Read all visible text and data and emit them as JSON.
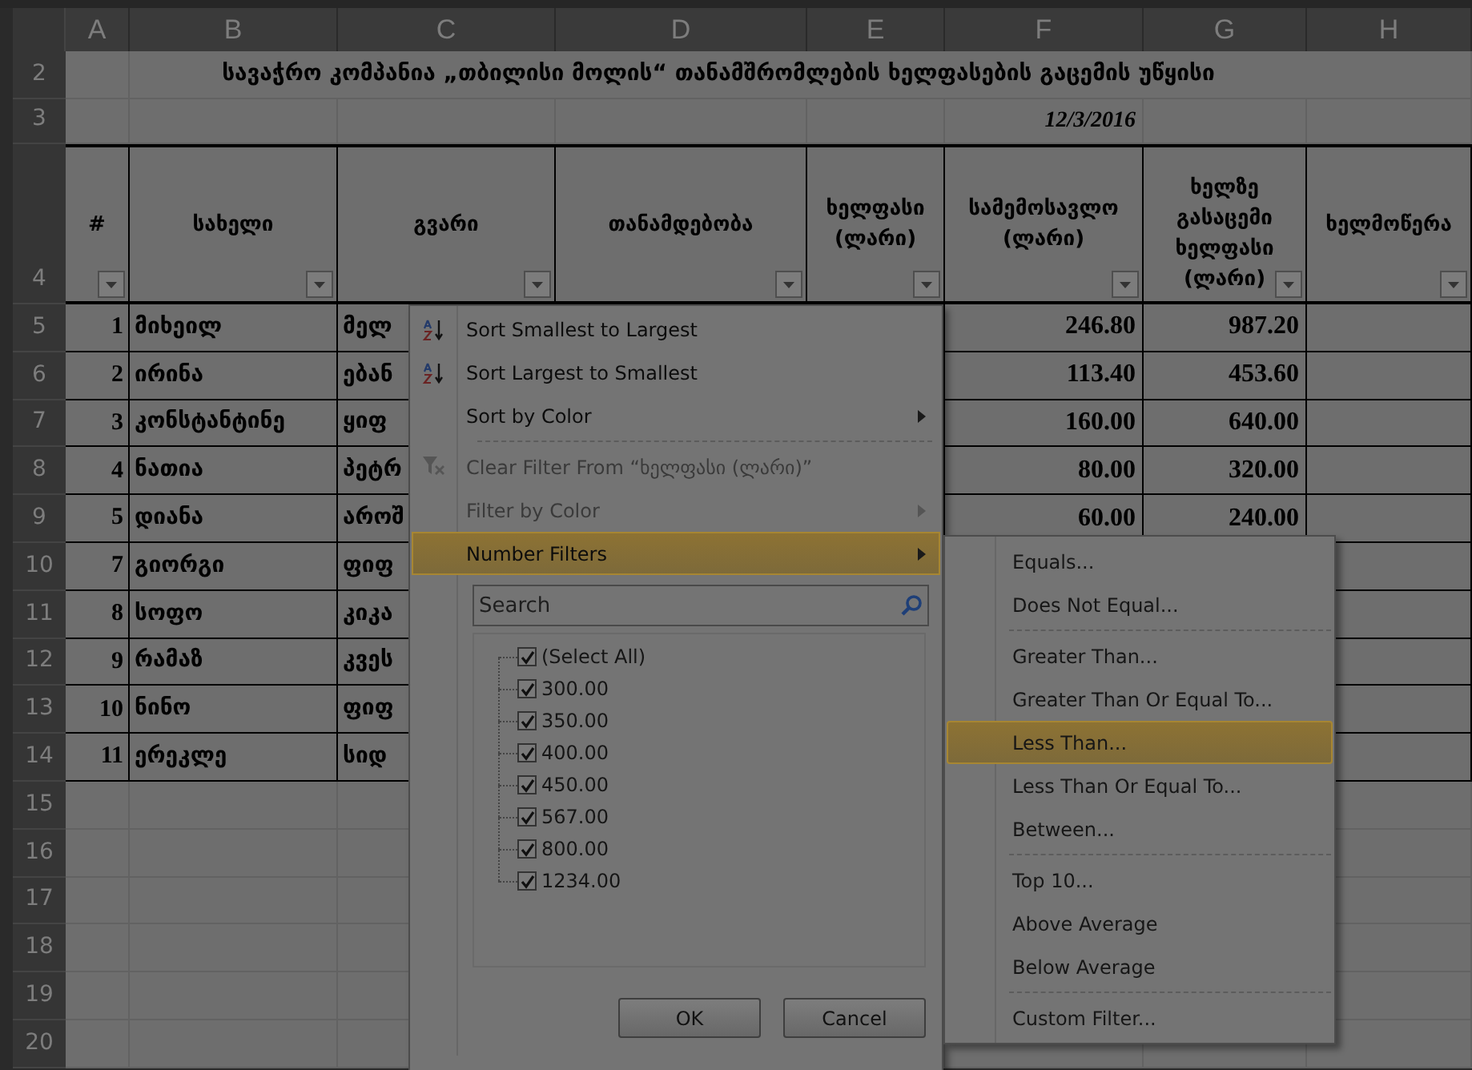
{
  "sheet": {
    "columns": [
      "A",
      "B",
      "C",
      "D",
      "E",
      "F",
      "G",
      "H"
    ],
    "title": {
      "row": "2",
      "text": "სავაჭრო კომპანია „თბილისი მოლის“ თანამშრომლების ხელფასების გაცემის უწყისი"
    },
    "date": {
      "row": "3",
      "text": "12/3/2016"
    },
    "header": {
      "row": "4",
      "labels": [
        "#",
        "სახელი",
        "გვარი",
        "თანამდებობა",
        "ხელფასი (ლარი)",
        "სამემოსავლო (ლარი)",
        "ხელზე გასაცემი ხელფასი (ლარი)",
        "ხელმოწერა"
      ]
    },
    "rows": [
      {
        "row": "5",
        "number": "1",
        "name": "მიხეილ",
        "surname": "მელ",
        "income_tax": "246.80",
        "net_pay": "987.20"
      },
      {
        "row": "6",
        "number": "2",
        "name": "ირინა",
        "surname": "ებან",
        "income_tax": "113.40",
        "net_pay": "453.60"
      },
      {
        "row": "7",
        "number": "3",
        "name": "კონსტანტინე",
        "surname": "ყიფ",
        "income_tax": "160.00",
        "net_pay": "640.00"
      },
      {
        "row": "8",
        "number": "4",
        "name": "ნათია",
        "surname": "პეტრ",
        "income_tax": "80.00",
        "net_pay": "320.00"
      },
      {
        "row": "9",
        "number": "5",
        "name": "დიანა",
        "surname": "აროშ",
        "income_tax": "60.00",
        "net_pay": "240.00"
      },
      {
        "row": "10",
        "number": "7",
        "name": "გიორგი",
        "surname": "ფიფ"
      },
      {
        "row": "11",
        "number": "8",
        "name": "სოფო",
        "surname": "კიკა"
      },
      {
        "row": "12",
        "number": "9",
        "name": "რამაზ",
        "surname": "კვეს"
      },
      {
        "row": "13",
        "number": "10",
        "name": "ნინო",
        "surname": "ფიფ"
      },
      {
        "row": "14",
        "number": "11",
        "name": "ერეკლე",
        "surname": "სიდ"
      }
    ],
    "empty_rows": [
      "15",
      "16",
      "17",
      "18",
      "19",
      "20"
    ]
  },
  "filter_menu": {
    "groups": [
      [
        {
          "kind": "sort-asc",
          "label": "Sort Smallest to Largest",
          "disabled": false,
          "selected": false
        },
        {
          "kind": "sort-desc",
          "label": "Sort Largest to Smallest",
          "disabled": false,
          "selected": false
        },
        {
          "kind": "submenu",
          "label": "Sort by Color",
          "disabled": false,
          "selected": false
        }
      ],
      [
        {
          "kind": "clear",
          "label": "Clear Filter From “ხელფასი (ლარი)”",
          "disabled": true,
          "selected": false
        },
        {
          "kind": "submenu",
          "label": "Filter by Color",
          "disabled": true,
          "selected": false
        },
        {
          "kind": "submenu",
          "label": "Number Filters",
          "disabled": false,
          "selected": true
        }
      ]
    ],
    "search": {
      "placeholder": "Search"
    },
    "values": [
      {
        "label": "(Select All)",
        "checked": true
      },
      {
        "label": "300.00",
        "checked": true
      },
      {
        "label": "350.00",
        "checked": true
      },
      {
        "label": "400.00",
        "checked": true
      },
      {
        "label": "450.00",
        "checked": true
      },
      {
        "label": "567.00",
        "checked": true
      },
      {
        "label": "800.00",
        "checked": true
      },
      {
        "label": "1234.00",
        "checked": true
      }
    ],
    "buttons": [
      "OK",
      "Cancel"
    ]
  },
  "number_filters_menu": {
    "groups": [
      [
        {
          "label": "Equals...",
          "selected": false
        },
        {
          "label": "Does Not Equal...",
          "selected": false
        }
      ],
      [
        {
          "label": "Greater Than...",
          "selected": false
        },
        {
          "label": "Greater Than Or Equal To...",
          "selected": false
        },
        {
          "label": "Less Than...",
          "selected": true
        },
        {
          "label": "Less Than Or Equal To...",
          "selected": false
        },
        {
          "label": "Between...",
          "selected": false
        }
      ],
      [
        {
          "label": "Top 10...",
          "selected": false
        },
        {
          "label": "Above Average",
          "selected": false
        },
        {
          "label": "Below Average",
          "selected": false
        }
      ],
      [
        {
          "label": "Custom Filter...",
          "selected": false
        }
      ]
    ]
  }
}
